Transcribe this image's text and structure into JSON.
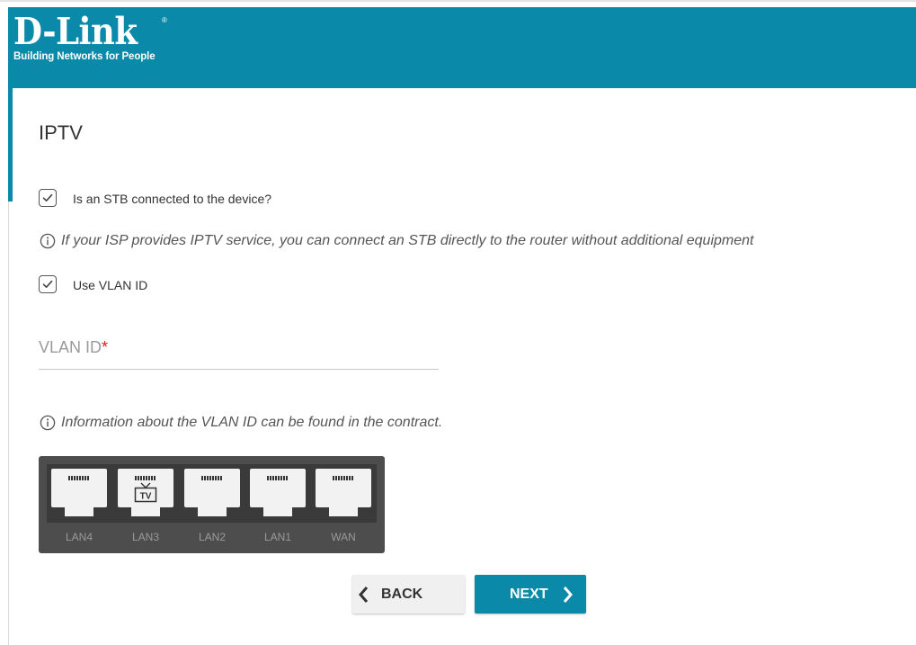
{
  "brand": {
    "logo_text": "D-Link",
    "registered_mark": "®",
    "tagline": "Building Networks for People"
  },
  "page": {
    "title": "IPTV"
  },
  "stb_checkbox": {
    "label": "Is an STB connected to the device?",
    "checked": true
  },
  "info_stb": "If your ISP provides IPTV service, you can connect an STB directly to the router without additional equipment",
  "vlan_checkbox": {
    "label": "Use VLAN ID",
    "checked": true
  },
  "vlan_field": {
    "label": "VLAN ID",
    "required_mark": "*",
    "value": ""
  },
  "info_vlan": "Information about the VLAN ID can be found in the contract.",
  "ports": [
    {
      "label": "LAN4",
      "stb": false
    },
    {
      "label": "LAN3",
      "stb": true,
      "stb_badge": "TV"
    },
    {
      "label": "LAN2",
      "stb": false
    },
    {
      "label": "LAN1",
      "stb": false
    },
    {
      "label": "WAN",
      "stb": false
    }
  ],
  "buttons": {
    "back_label": "BACK",
    "next_label": "NEXT"
  },
  "colors": {
    "brand": "#0a8aa8",
    "port_panel": "#4d4d4d",
    "required": "#cc2222"
  },
  "icons": {
    "back": "chevron-left-icon",
    "next": "chevron-right-icon",
    "info": "info-icon",
    "check": "checkmark-icon",
    "tv": "tv-icon"
  }
}
